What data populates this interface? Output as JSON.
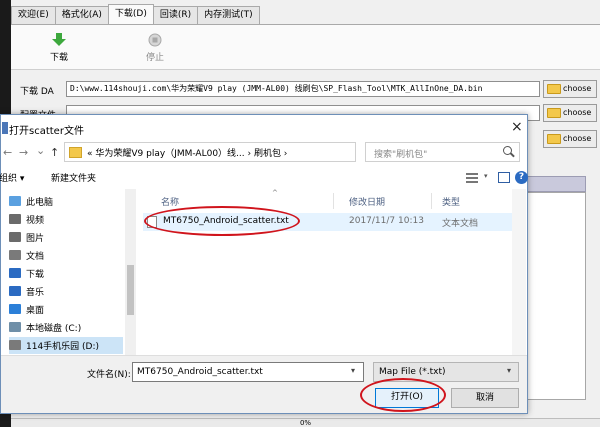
{
  "app": {
    "tabs": [
      {
        "label": "欢迎(E)"
      },
      {
        "label": "格式化(A)"
      },
      {
        "label": "下载(D)"
      },
      {
        "label": "回读(R)"
      },
      {
        "label": "内存测试(T)"
      }
    ],
    "toolbar": {
      "download_label": "下载",
      "stop_label": "停止"
    },
    "download_agent_label": "下载 DA",
    "download_agent_path": "D:\\www.114shouji.com\\华为荣耀V9 play (JMM-AL00) 线刷包\\SP_Flash_Tool\\MTK_AllInOne_DA.bin",
    "scatter_label": "配置文件",
    "choose_label": "choose",
    "progress_text": "0%"
  },
  "dialog": {
    "title": "打开scatter文件",
    "close_glyph": "×",
    "nav_back": "←",
    "nav_forward": "→",
    "nav_recent": "⌄",
    "nav_up": "↑",
    "address": {
      "prefix": "«",
      "segments": "华为荣耀V9 play（JMM-AL00）线...  ›  刷机包  ›"
    },
    "search_placeholder": "搜索\"刷机包\"",
    "commands": {
      "organize": "组织 ▾",
      "new_folder": "新建文件夹"
    },
    "nav_items": [
      {
        "label": "此电脑",
        "color": "#5aa0e0"
      },
      {
        "label": "视频",
        "color": "#6b6b6b"
      },
      {
        "label": "图片",
        "color": "#6b6b6b"
      },
      {
        "label": "文档",
        "color": "#7a7a7a"
      },
      {
        "label": "下载",
        "color": "#2b6bc2"
      },
      {
        "label": "音乐",
        "color": "#2b6bc2"
      },
      {
        "label": "桌面",
        "color": "#2b7fd8"
      },
      {
        "label": "本地磁盘 (C:)",
        "color": "#6f8fa8"
      },
      {
        "label": "114手机乐园 (D:)",
        "color": "#7a7a7a"
      }
    ],
    "columns": {
      "name": "名称",
      "modified": "修改日期",
      "type": "类型"
    },
    "files": [
      {
        "name": "MT6750_Android_scatter.txt",
        "modified": "2017/11/7 10:13",
        "type": "文本文档"
      }
    ],
    "filename_label": "文件名(N):",
    "filename_value": "MT6750_Android_scatter.txt",
    "filter_value": "Map File (*.txt)",
    "open_label": "打开(O)",
    "cancel_label": "取消"
  },
  "colors": {
    "accent": "#0078d7",
    "highlight_ring": "#d0141c",
    "selected_row": "#e5f3ff"
  }
}
